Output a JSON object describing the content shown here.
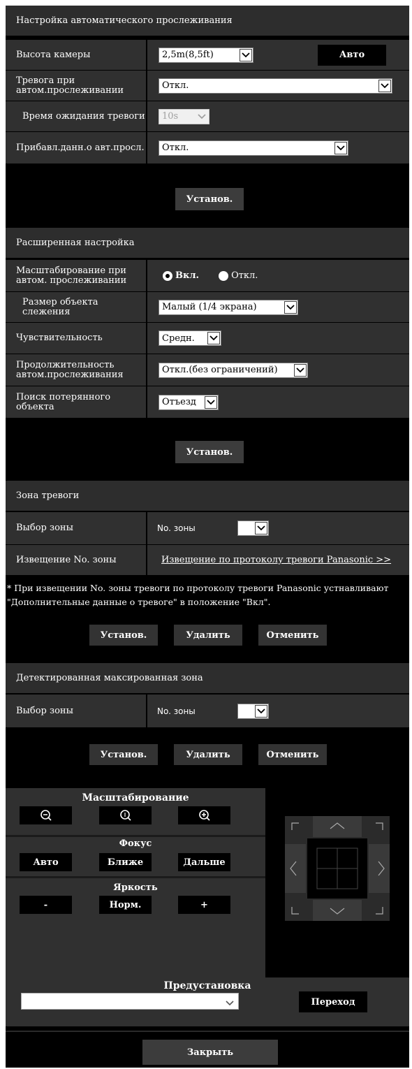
{
  "autotrack": {
    "title": "Настройка автоматического прослеживания",
    "camera_height_label": "Высота камеры",
    "camera_height_value": "2,5m(8,5ft)",
    "auto_button": "Авто",
    "alarm_label": "Тревога при автом.прослеживании",
    "alarm_value": "Откл.",
    "wait_label": "Время ожидания тревоги",
    "wait_value": "10s",
    "add_data_label": "Прибавл.данн.о авт.просл.",
    "add_data_value": "Откл.",
    "set_button": "Установ."
  },
  "advanced": {
    "title": "Расширенная настройка",
    "zoom_label": "Масштабирование при автом. прослеживании",
    "zoom_on": "Вкл.",
    "zoom_off": "Откл.",
    "size_label": "Размер объекта слежения",
    "size_value": "Малый (1/4 экрана)",
    "sens_label": "Чувствительность",
    "sens_value": "Средн.",
    "dur_label": "Продолжительность автом.прослеживания",
    "dur_value": "Откл.(без ограничений)",
    "lost_label": "Поиск потерянного объекта",
    "lost_value": "Отъезд",
    "set_button": "Установ."
  },
  "alarm_zone": {
    "title": "Зона тревоги",
    "select_label": "Выбор зоны",
    "zone_no": "No. зоны",
    "notify_label": "Извещение No. зоны",
    "notify_link": "Извещение по протоколу тревоги Panasonic >>",
    "note": "* При извещении No. зоны тревоги по протоколу тревоги Panasonic устнавливают \"Дополнительные данные о тревоге\" в положение \"Вкл\".",
    "set_button": "Установ.",
    "delete_button": "Удалить",
    "cancel_button": "Отменить"
  },
  "mask_zone": {
    "title": "Детектированная максированная зона",
    "select_label": "Выбор зоны",
    "zone_no": "No. зоны",
    "set_button": "Установ.",
    "delete_button": "Удалить",
    "cancel_button": "Отменить"
  },
  "controls": {
    "zoom_title": "Масштабирование",
    "focus_title": "Фокус",
    "focus_auto": "Авто",
    "focus_near": "Ближе",
    "focus_far": "Дальше",
    "bright_title": "Яркость",
    "bright_minus": "-",
    "bright_norm": "Норм.",
    "bright_plus": "+",
    "preset_title": "Предустановка",
    "preset_value": "",
    "goto_button": "Переход",
    "close_button": "Закрыть"
  }
}
